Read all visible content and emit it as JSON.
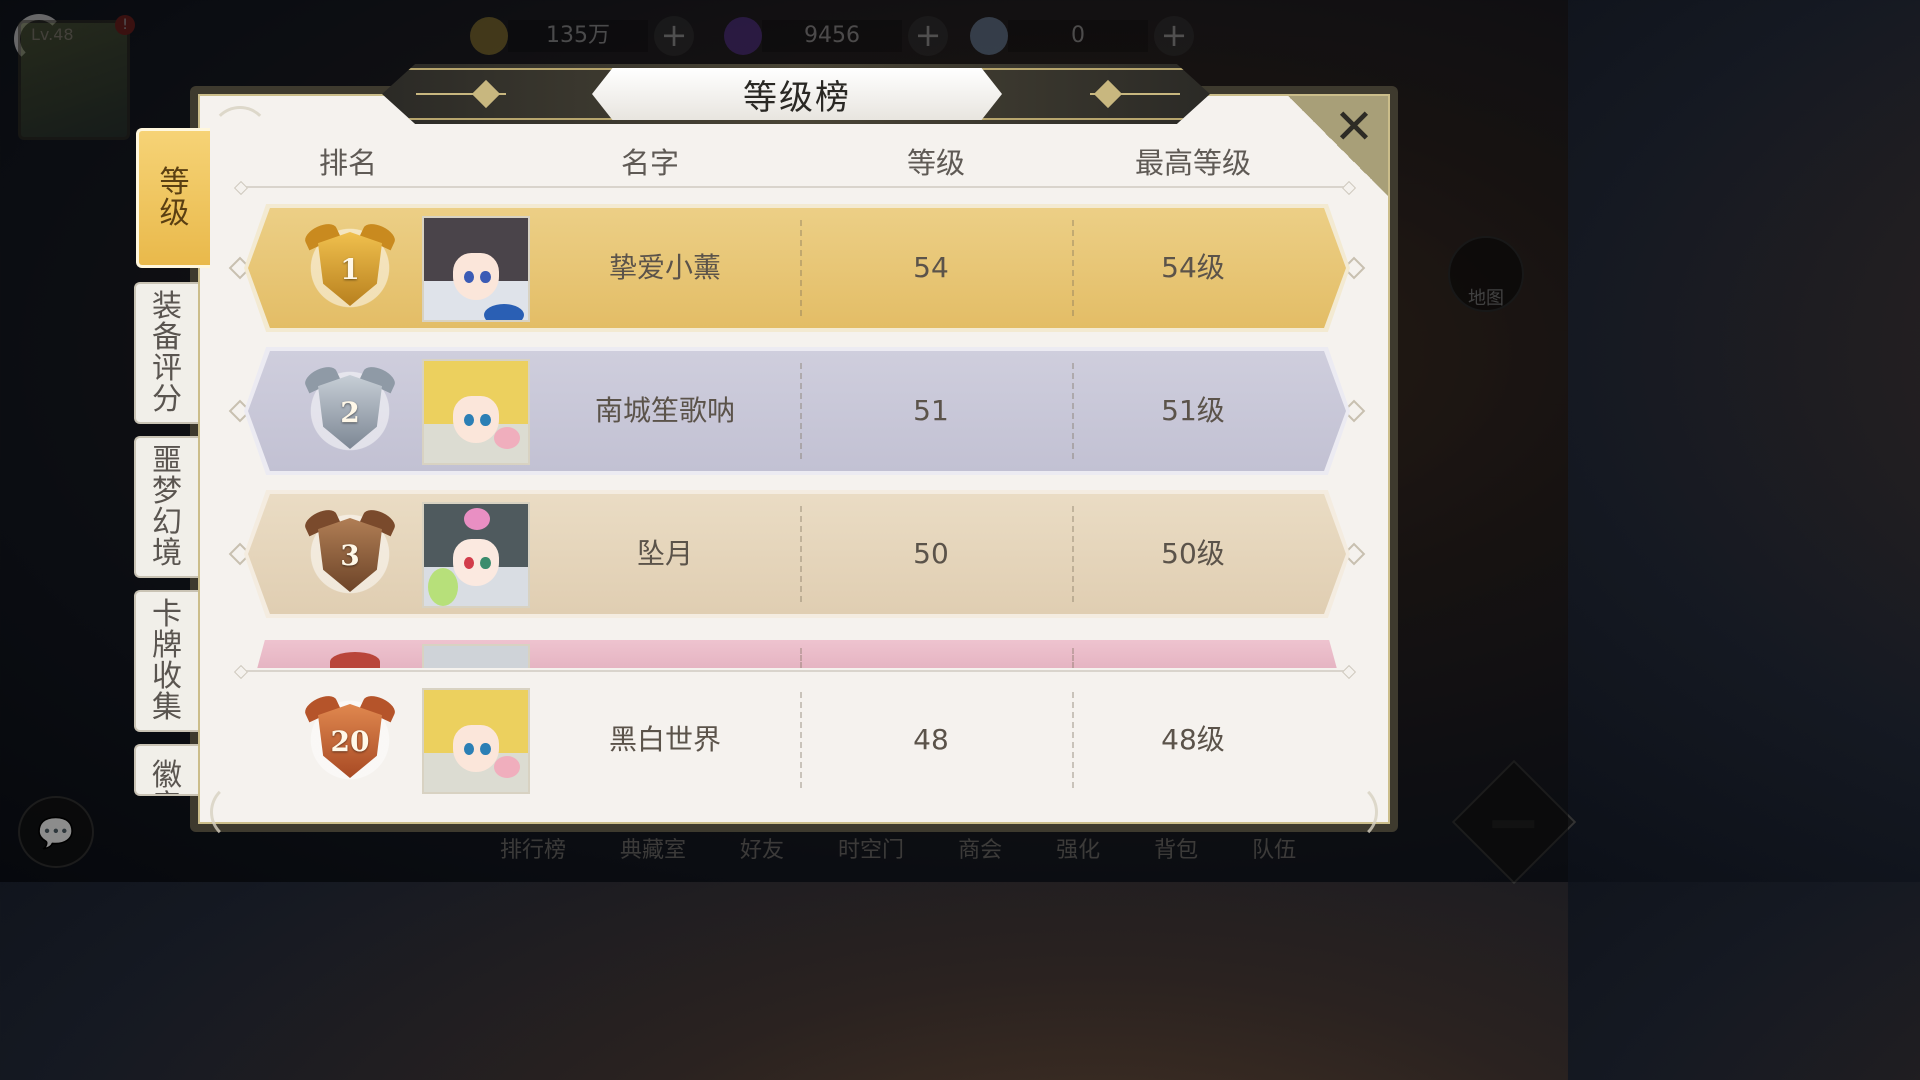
{
  "hud": {
    "level_text": "Lv.48",
    "alert_mark": "!",
    "currencies": [
      {
        "name": "gold-coin-icon",
        "value": "135万",
        "color": "#b59a3c"
      },
      {
        "name": "purple-gem-icon",
        "value": "9456",
        "color": "#6a3db0"
      },
      {
        "name": "rainbow-orb-icon",
        "value": "0",
        "color": "#8aa6c8"
      }
    ],
    "plus_label": "+",
    "bottom_nav": [
      "排行榜",
      "典藏室",
      "好友",
      "时空门",
      "商会",
      "强化",
      "背包",
      "队伍"
    ],
    "right_buttons": [
      "地图"
    ]
  },
  "panel": {
    "title": "等级榜",
    "close_label": "✕",
    "tabs": [
      {
        "label": "等\n级",
        "active": true
      },
      {
        "label": "装\n备\n评\n分",
        "active": false
      },
      {
        "label": "噩\n梦\n幻\n境",
        "active": false
      },
      {
        "label": "卡\n牌\n收\n集",
        "active": false
      },
      {
        "label": "徽\n章",
        "active": false
      }
    ],
    "columns": {
      "rank": "排名",
      "name": "名字",
      "level": "等级",
      "max_level": "最高等级"
    },
    "rows": [
      {
        "rank": "1",
        "name": "挚爱小薰",
        "level": "54",
        "max_level": "54级",
        "row_color": "#e9c77a",
        "badge_color": "#d9a23a",
        "portrait": "dark-hair"
      },
      {
        "rank": "2",
        "name": "南城笙歌呐",
        "level": "51",
        "max_level": "51级",
        "row_color": "#c9c8d8",
        "badge_color": "#a9b1bb",
        "portrait": "blonde-elf"
      },
      {
        "rank": "3",
        "name": "坠月",
        "level": "50",
        "max_level": "50级",
        "row_color": "#e6d6bc",
        "badge_color": "#9c6b45",
        "portrait": "green-hood"
      }
    ],
    "partial_row_color": "#e9b8c6",
    "self_row": {
      "rank": "20",
      "name": "黑白世界",
      "level": "48",
      "max_level": "48级",
      "badge_color": "#c7683b",
      "portrait": "blonde-elf"
    }
  }
}
